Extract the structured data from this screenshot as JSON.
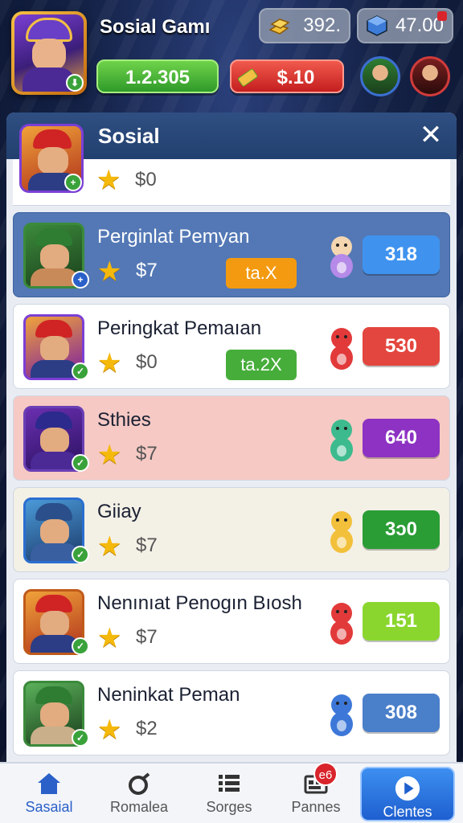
{
  "header": {
    "player_name": "Sosial Gamı",
    "resource_1": {
      "icon": "gold-bars-icon",
      "value": "392."
    },
    "resource_2": {
      "icon": "gem-cube-icon",
      "value": "47.00"
    },
    "cash_button": "1.2.305",
    "energy_button": "$.10"
  },
  "panel": {
    "title": "Sosial",
    "partial_row": {
      "money": "$0"
    },
    "rows": [
      {
        "name": "Perginlat Pemyan",
        "money": "$7",
        "tag": "ta.X",
        "tag_color": "#f39a10",
        "score": "318",
        "score_color": "#3f93ef",
        "row_bg": "#5378b5"
      },
      {
        "name": "Peringkat Pemaıan",
        "money": "$0",
        "tag": "ta.2X",
        "tag_color": "#46ad3a",
        "score": "530",
        "score_color": "#e3463e",
        "row_bg": "#ffffff"
      },
      {
        "name": "Sthies",
        "money": "$7",
        "tag": "",
        "score": "640",
        "score_color": "#8d32c2",
        "row_bg": "#f6c9c4"
      },
      {
        "name": "Giiay",
        "money": "$7",
        "tag": "",
        "score": "3ɔ0",
        "score_color": "#2a9d35",
        "row_bg": "#f3f0e6"
      },
      {
        "name": "Nenınıat Penogın Bıosh",
        "money": "$7",
        "tag": "",
        "score": "151",
        "score_color": "#8ad62e",
        "row_bg": "#ffffff"
      },
      {
        "name": "Neninkat Peman",
        "money": "$2",
        "tag": "",
        "score": "308",
        "score_color": "#4a7fc9",
        "row_bg": "#ffffff"
      }
    ]
  },
  "nav": {
    "items": [
      {
        "label": "Sasaial",
        "icon": "home-icon"
      },
      {
        "label": "Romalea",
        "icon": "ring-icon"
      },
      {
        "label": "Sorges",
        "icon": "list-icon"
      },
      {
        "label": "Pannes",
        "icon": "calendar-grid-icon",
        "badge": "e6"
      },
      {
        "label": "Clentes",
        "icon": "play-icon"
      }
    ]
  }
}
